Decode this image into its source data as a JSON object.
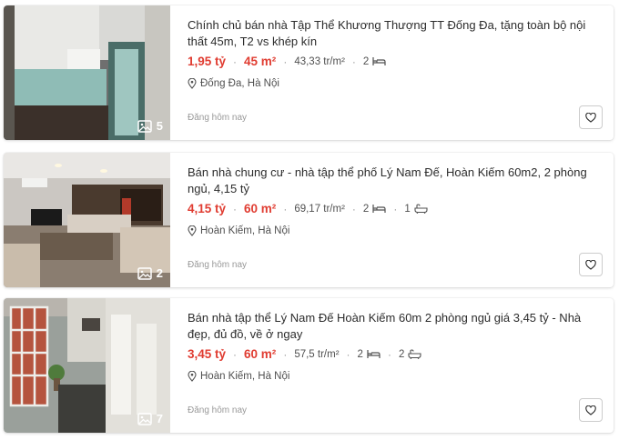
{
  "listings": [
    {
      "title": "Chính chủ bán nhà Tập Thể Khương Thượng TT Đống Đa, tặng toàn bộ nội thất 45m, T2 vs khép kín",
      "price": "1,95 tỷ",
      "area": "45 m²",
      "price_per_m2": "43,33 tr/m²",
      "bedrooms": "2",
      "location": "Đống Đa, Hà Nội",
      "posted": "Đăng hôm nay",
      "photo_count": "5"
    },
    {
      "title": "Bán nhà chung cư - nhà tập thể phố Lý Nam Đế, Hoàn Kiếm 60m2, 2 phòng ngủ, 4,15 tỷ",
      "price": "4,15 tỷ",
      "area": "60 m²",
      "price_per_m2": "69,17 tr/m²",
      "bedrooms": "2",
      "bathrooms": "1",
      "location": "Hoàn Kiếm, Hà Nội",
      "posted": "Đăng hôm nay",
      "photo_count": "2"
    },
    {
      "title": "Bán nhà tập thể Lý Nam Đế Hoàn Kiếm 60m 2 phòng ngủ giá 3,45 tỷ - Nhà đẹp, đủ đồ, về ở ngay",
      "price": "3,45 tỷ",
      "area": "60 m²",
      "price_per_m2": "57,5 tr/m²",
      "bedrooms": "2",
      "bathrooms": "2",
      "location": "Hoàn Kiếm, Hà Nội",
      "posted": "Đăng hôm nay",
      "photo_count": "7"
    }
  ],
  "icons": {
    "photo": "image-gallery-icon",
    "bed": "bed-icon",
    "bath": "bathtub-icon",
    "location": "map-pin-icon",
    "favorite": "heart-outline-icon"
  },
  "colors": {
    "price_accent": "#e03c31",
    "muted_text": "#999999"
  }
}
